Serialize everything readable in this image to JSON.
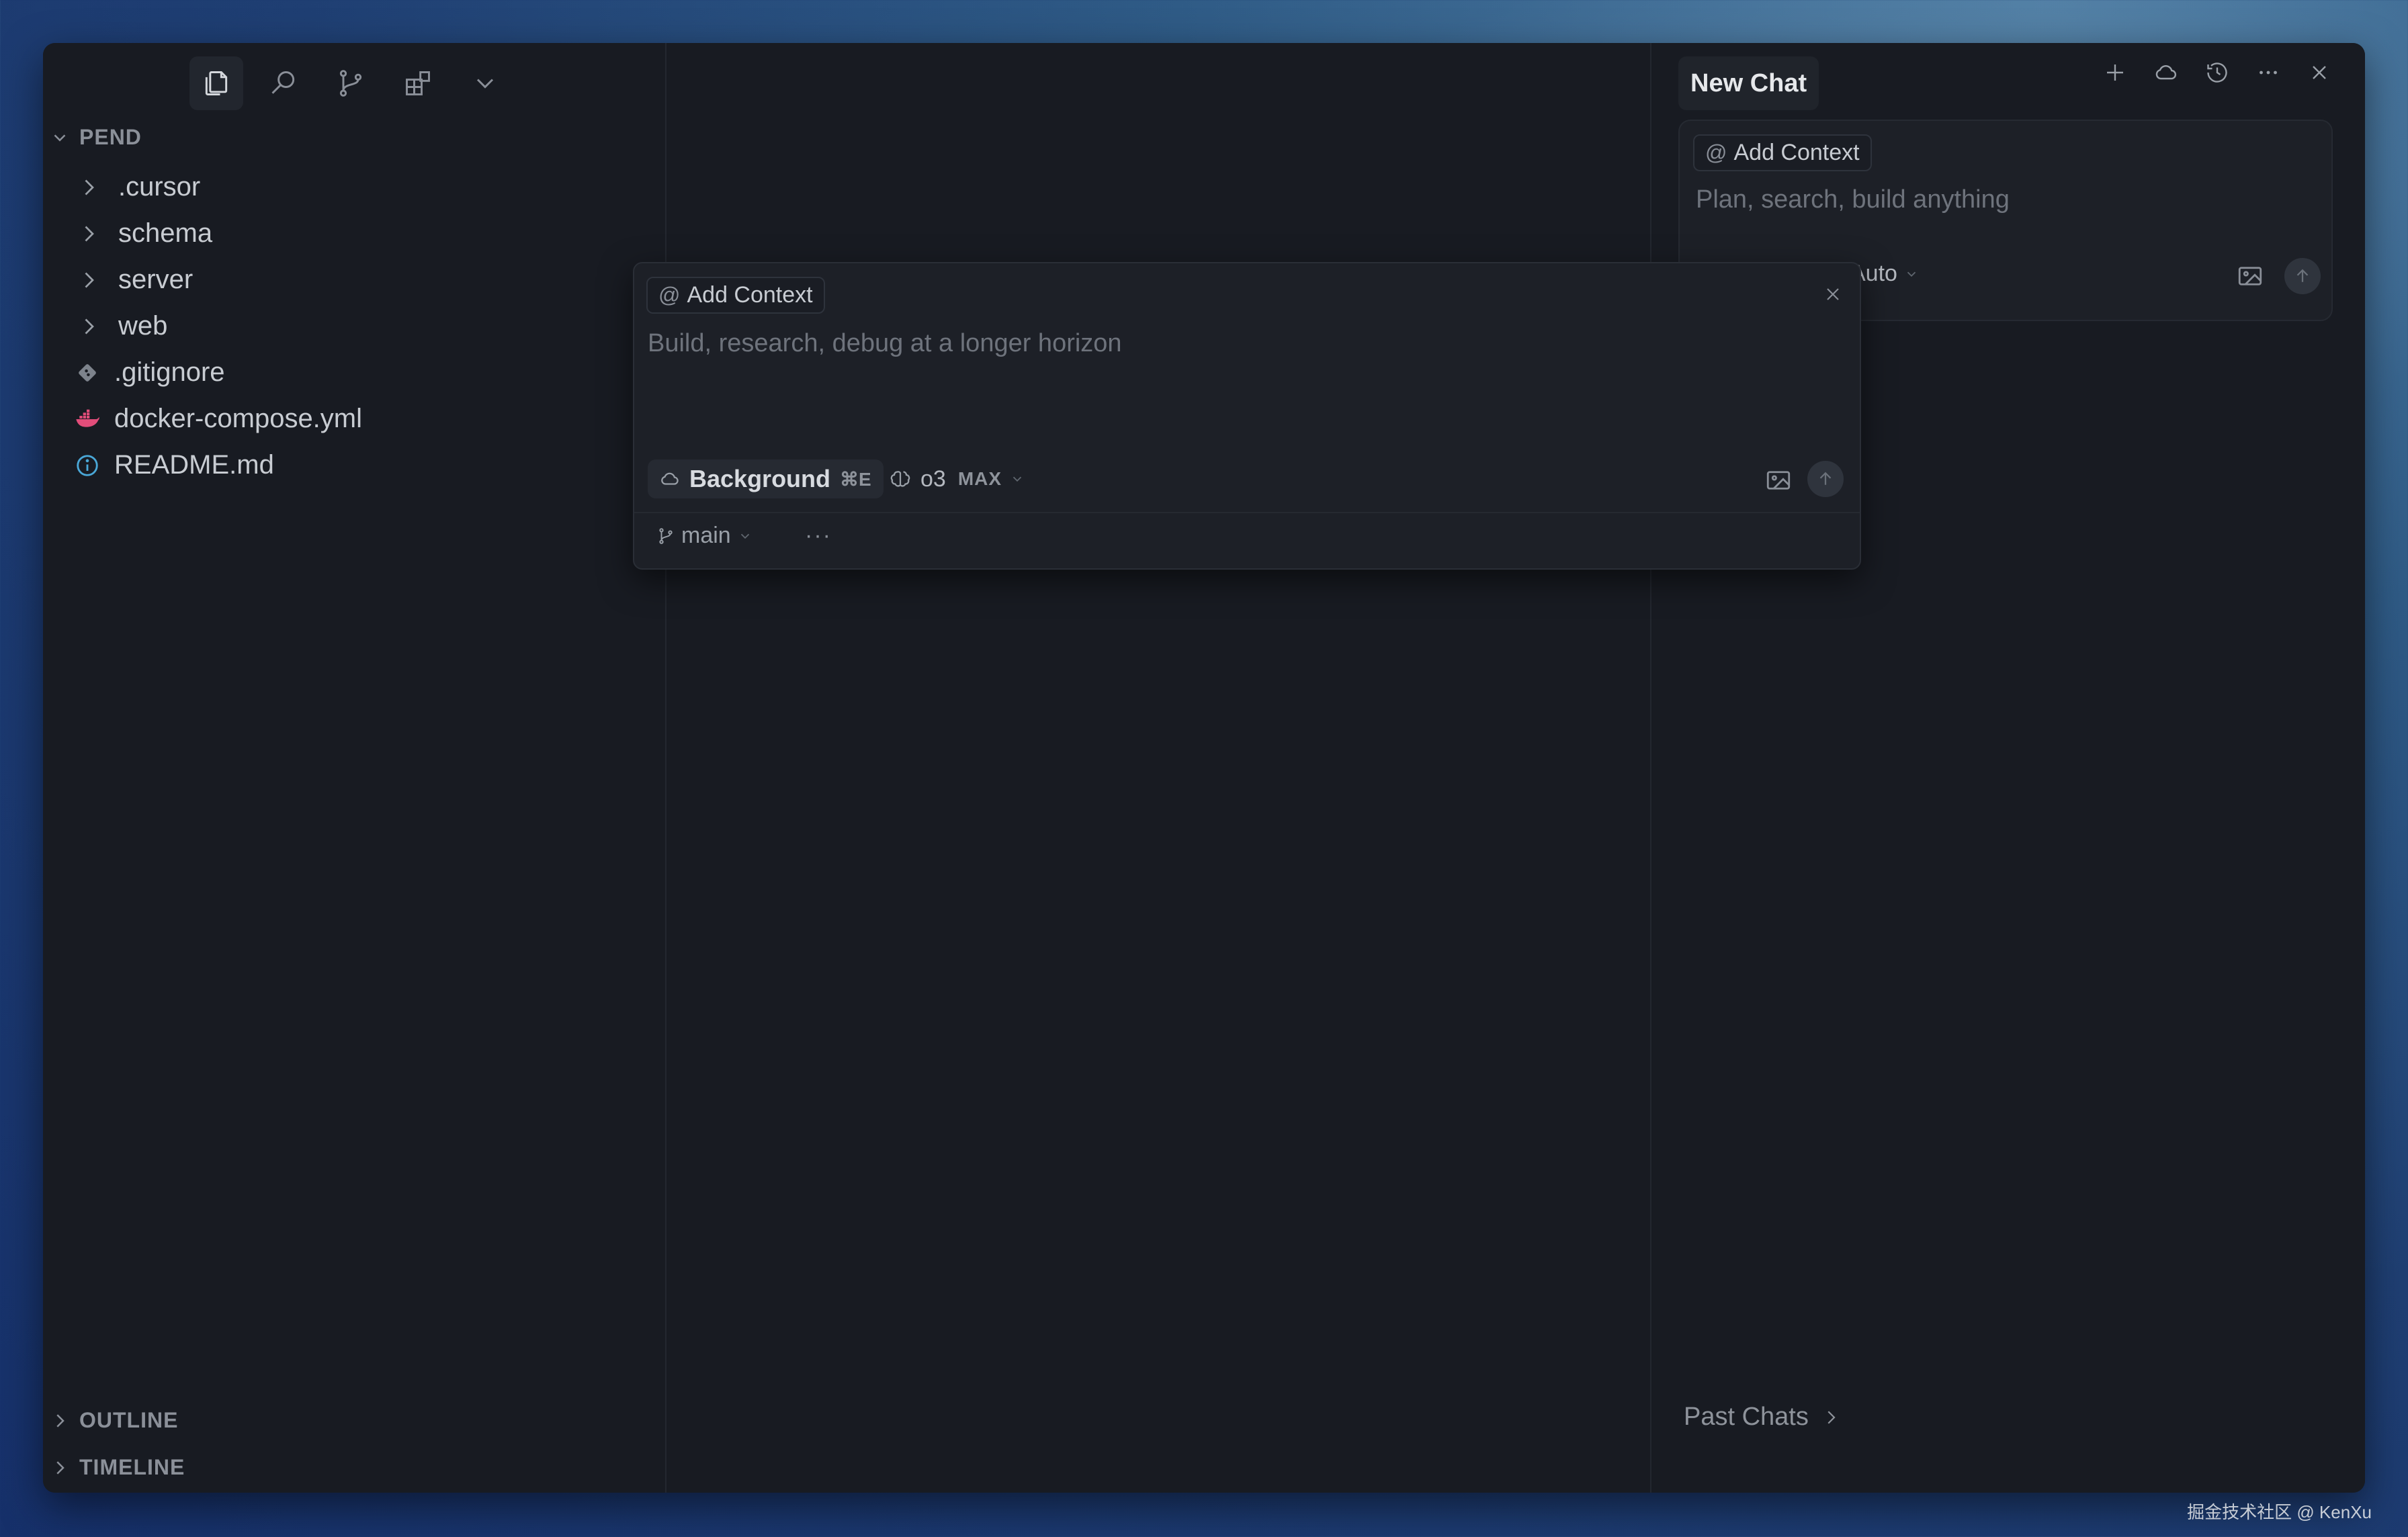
{
  "sidebar": {
    "project_name": "PEND",
    "items": [
      {
        "label": ".cursor",
        "type": "folder"
      },
      {
        "label": "schema",
        "type": "folder"
      },
      {
        "label": "server",
        "type": "folder"
      },
      {
        "label": "web",
        "type": "folder"
      },
      {
        "label": ".gitignore",
        "type": "file",
        "icon": "git-icon"
      },
      {
        "label": "docker-compose.yml",
        "type": "file",
        "icon": "docker-icon"
      },
      {
        "label": "README.md",
        "type": "file",
        "icon": "info-icon"
      }
    ],
    "outline_label": "OUTLINE",
    "timeline_label": "TIMELINE"
  },
  "popup": {
    "add_context": "Add Context",
    "placeholder": "Build, research, debug at a longer horizon",
    "background_label": "Background",
    "background_shortcut": "⌘E",
    "model": "o3",
    "model_badge": "MAX",
    "branch": "main",
    "more": "···"
  },
  "chat": {
    "title": "New Chat",
    "add_context": "Add Context",
    "placeholder": "Plan, search, build anything",
    "mode": "Auto",
    "past_chats": "Past Chats"
  },
  "watermark": "掘金技术社区 @ KenXu",
  "colors": {
    "window_bg": "#181b22",
    "docker_icon": "#e24d7a",
    "info_icon": "#4aa8d8",
    "git_icon": "#7d838c"
  }
}
